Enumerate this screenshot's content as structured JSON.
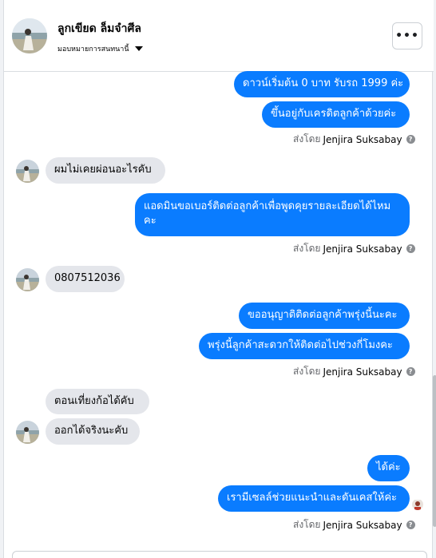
{
  "header": {
    "contact_name": "ลูกเขียด ล็มจำศีล",
    "assign_label": "มอบหมายการสนทนานี้",
    "more_label": "•••"
  },
  "messages": {
    "m1": "ดาวน์เริ่มต้น 0 บาท รับรถ 1999 ค่ะ",
    "m2": "ขึ้นอยู่กับเครดิตลูกค้าด้วยค่ะ",
    "m3": "ผมไม่เคยผ่อนอะไรคับ",
    "m4": "แอดมินขอเบอร์ติดต่อลูกค้าเพื่อพูดคุยรายละเอียดได้ไหมคะ",
    "m5": "0807512036",
    "m6": "ขออนุญาติติดต่อลูกค้าพรุ่งนี้นะคะ",
    "m7": "พรุ่งนี้ลูกค้าสะดวกให้ติดต่อไปช่วงกี่โมงคะ",
    "m8": "ตอนเที่ยงก้อได้คับ",
    "m9": "ออกได้จริงนะคับ",
    "m10": "ได้ค่ะ",
    "m11": "เรามีเซลล์ช่วยแนะนำและดันเคสให้ค่ะ"
  },
  "sent_by": {
    "prefix": "ส่งโดย",
    "agent": "Jenjira Suksabay",
    "info": "?"
  },
  "colors": {
    "outgoing": "#0a7cff",
    "incoming": "#e4e6eb"
  }
}
